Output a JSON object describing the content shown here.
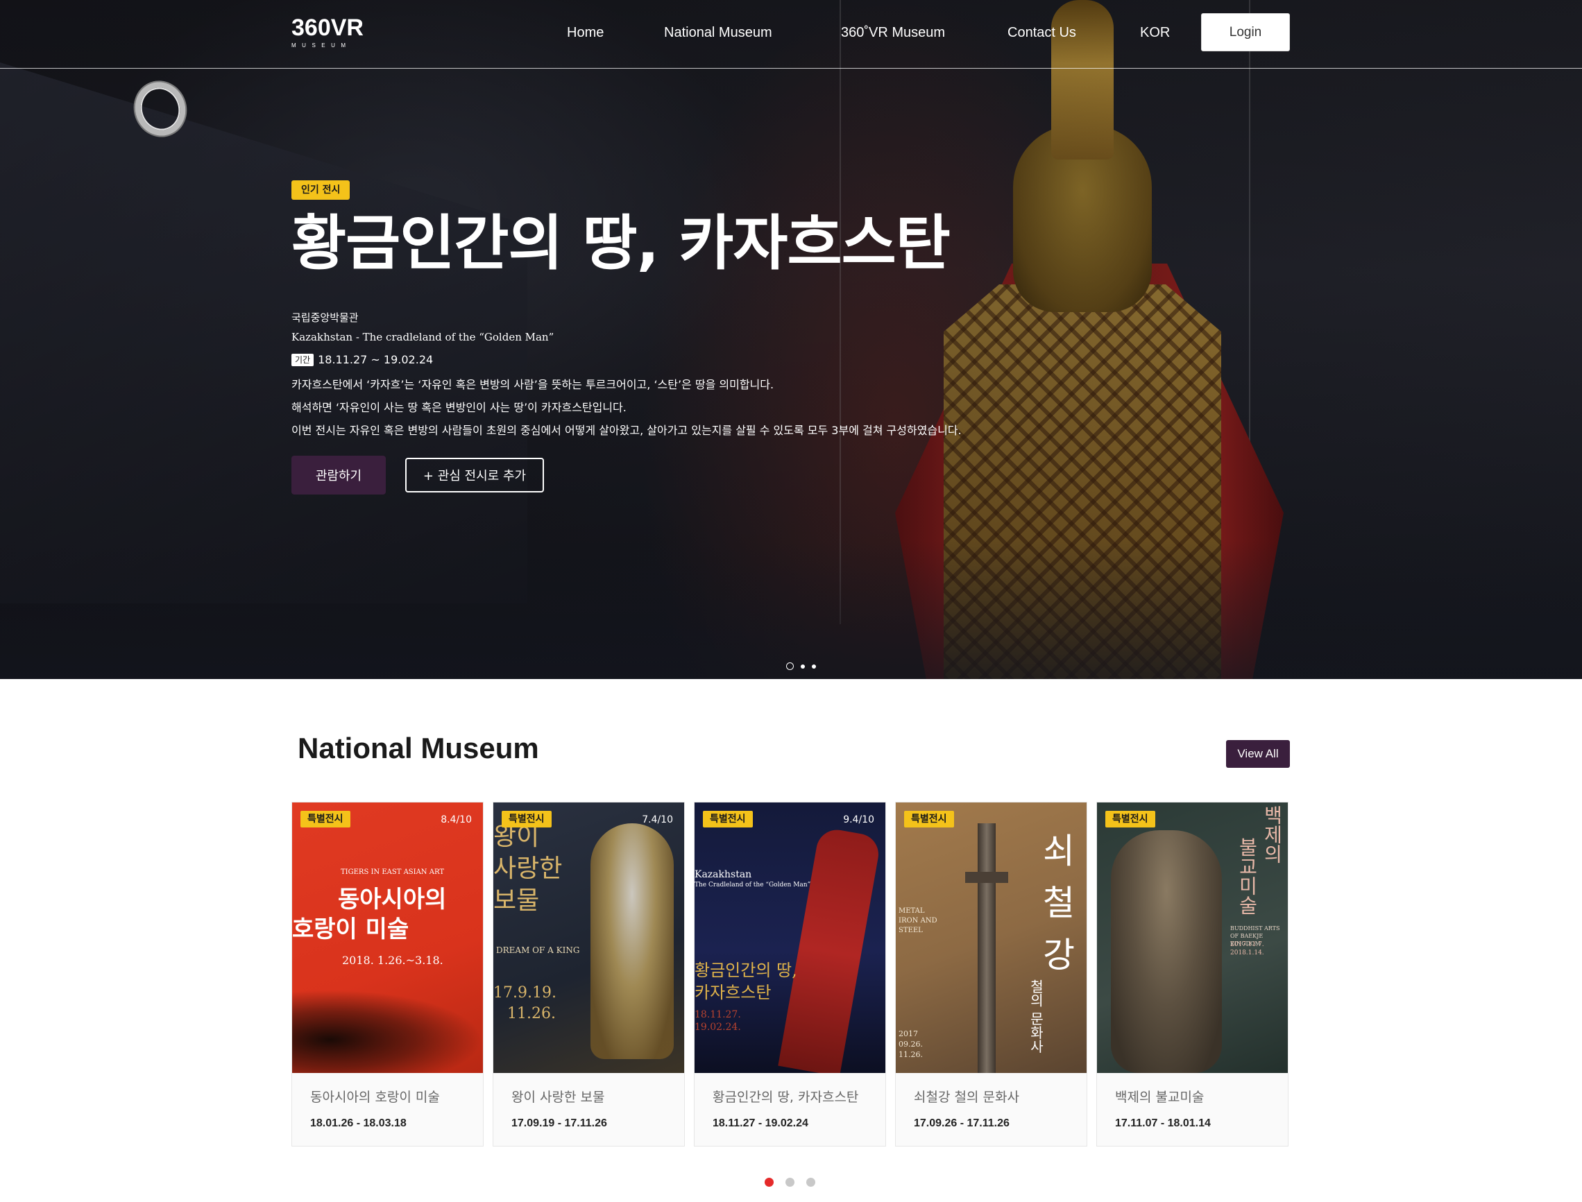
{
  "header": {
    "logo_main": "360VR",
    "logo_sub": "MUSEUM",
    "nav": [
      "Home",
      "National Museum",
      "360˚VR Museum",
      "Contact Us",
      "KOR"
    ],
    "login": "Login"
  },
  "hero": {
    "badge": "인기 전시",
    "title": "황금인간의 땅, 카자흐스탄",
    "org": "국립중앙박물관",
    "subtitle_en": "Kazakhstan - The cradleland of the “Golden Man”",
    "period_tag": "기간",
    "period": "18.11.27 ~ 19.02.24",
    "description": [
      "카자흐스탄에서 ‘카자흐’는 ‘자유인 혹은 변방의 사람’을 뜻하는 투르크어이고, ‘스탄’은 땅을 의미합니다.",
      "해석하면 ‘자유인이 사는 땅 혹은 변방인이 사는 땅’이 카자흐스탄입니다.",
      "이번 전시는 자유인 혹은 변방의 사람들이 초원의 중심에서 어떻게 살아왔고, 살아가고 있는지를 살필 수 있도록 모두 3부에 걸쳐 구성하였습니다."
    ],
    "btn_view": "관람하기",
    "btn_fav": "+ 관심 전시로 추가",
    "slides": 3,
    "active_slide": 0
  },
  "section": {
    "title": "National Museum",
    "view_all": "View All",
    "cards": [
      {
        "badge": "특별전시",
        "score": "8.4/10",
        "poster_lines": [
          "TIGERS IN EAST ASIAN ART",
          "동아시아의",
          "호랑이 미술",
          "2018. 1.26.~3.18."
        ],
        "title": "동아시아의 호랑이 미술",
        "date": "18.01.26 - 18.03.18"
      },
      {
        "badge": "특별전시",
        "score": "7.4/10",
        "poster_lines": [
          "왕이",
          "사랑한",
          "보물",
          "DREAM OF A KING",
          "17.9.19.",
          "11.26."
        ],
        "title": "왕이 사랑한 보물",
        "date": "17.09.19 - 17.11.26"
      },
      {
        "badge": "특별전시",
        "score": "9.4/10",
        "poster_lines": [
          "Kazakhstan",
          "The Cradleland of the “Golden Man”",
          "황금인간의 땅,",
          "카자흐스탄",
          "18.11.27.",
          "19.02.24."
        ],
        "title": "황금인간의 땅, 카자흐스탄",
        "date": "18.11.27 - 19.02.24"
      },
      {
        "badge": "특별전시",
        "score": "",
        "poster_lines": [
          "쇠",
          "철",
          "강",
          "철의 문화사",
          "METAL IRON AND STEEL",
          "2017 09.26. 11.26."
        ],
        "title": "쇠철강 철의 문화사",
        "date": "17.09.26 - 17.11.26"
      },
      {
        "badge": "특별전시",
        "score": "",
        "poster_lines": [
          "백제의",
          "불교미술",
          "BUDDHIST ARTS OF BAEKJE KINGDOM",
          "2017.11.7.",
          "2018.1.14."
        ],
        "title": "백제의 불교미술",
        "date": "17.11.07 - 18.01.14"
      }
    ],
    "pages": 3,
    "active_page": 0
  },
  "colors": {
    "accent_dark": "#3a1f3d",
    "badge_yellow": "#f4c21a",
    "dot_active": "#e52a2a"
  }
}
